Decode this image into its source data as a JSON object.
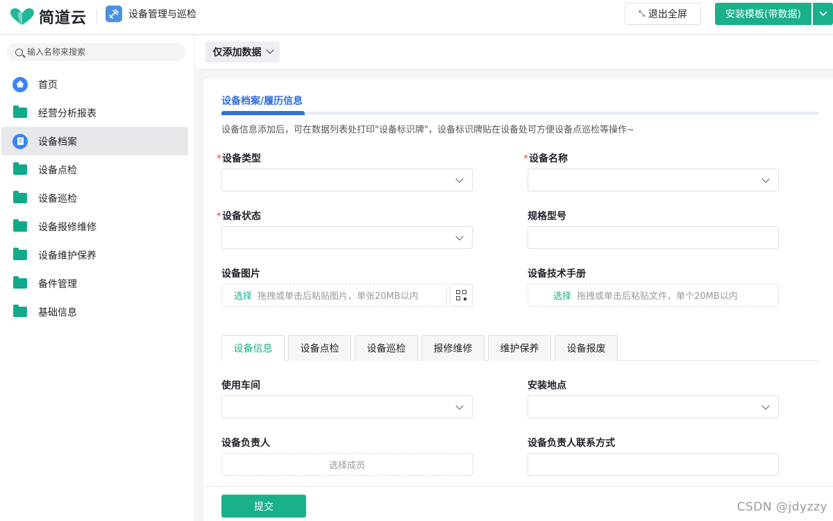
{
  "header": {
    "brand": "简道云",
    "app_name": "设备管理与巡检",
    "exit_fullscreen": "退出全屏",
    "install_template": "安装模板(带数据)",
    "accent": "#19b08a"
  },
  "sidebar": {
    "search_placeholder": "输入名称来搜索",
    "items": [
      {
        "label": "首页",
        "icon": "home-icon"
      },
      {
        "label": "经营分析报表",
        "icon": "folder-icon"
      },
      {
        "label": "设备档案",
        "icon": "document-icon",
        "active": true
      },
      {
        "label": "设备点检",
        "icon": "folder-icon"
      },
      {
        "label": "设备巡检",
        "icon": "folder-icon"
      },
      {
        "label": "设备报修维修",
        "icon": "folder-icon"
      },
      {
        "label": "设备维护保养",
        "icon": "folder-icon"
      },
      {
        "label": "备件管理",
        "icon": "folder-icon"
      },
      {
        "label": "基础信息",
        "icon": "folder-icon"
      }
    ]
  },
  "toolbar": {
    "mode": "仅添加数据"
  },
  "form": {
    "section_title": "设备档案/履历信息",
    "description": "设备信息添加后，可在数据列表处打印\"设备标识牌\"，设备标识牌贴在设备处可方便设备点巡检等操作~",
    "required_mark": "*",
    "fields": {
      "device_type": "设备类型",
      "device_name": "设备名称",
      "device_status": "设备状态",
      "spec_model": "规格型号",
      "device_image": "设备图片",
      "tech_manual": "设备技术手册",
      "workshop": "使用车间",
      "location": "安装地点",
      "owner": "设备负责人",
      "owner_contact": "设备负责人联系方式"
    },
    "upload": {
      "pick": "选择",
      "image_hint": "拖拽或单击后粘贴图片，单张20MB以内",
      "file_hint": "拖拽或单击后粘贴文件，单个20MB以内"
    },
    "member_placeholder": "选择成员",
    "tabs": [
      "设备信息",
      "设备点检",
      "设备巡检",
      "报修维修",
      "维护保养",
      "设备报废"
    ],
    "submit": "提交"
  },
  "watermark": "CSDN @jdyzzy"
}
